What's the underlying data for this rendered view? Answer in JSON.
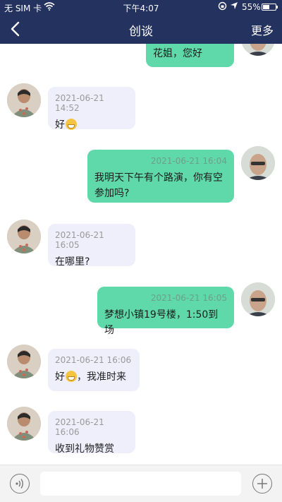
{
  "status_bar": {
    "carrier": "无 SIM 卡",
    "time": "下午4:07",
    "battery": "55%",
    "battery_level": 0.55
  },
  "nav": {
    "title": "创谈",
    "more": "更多"
  },
  "messages": [
    {
      "side": "out",
      "timestamp": "",
      "text": "花姐，您好"
    },
    {
      "side": "in",
      "timestamp": "2021-06-21 14:52",
      "text": "好"
    },
    {
      "side": "out",
      "timestamp": "2021-06-21 16:04",
      "text_line1": "我明天下午有个路演，你有空",
      "text_line2": "参加吗?"
    },
    {
      "side": "in",
      "timestamp": "2021-06-21 16:05",
      "text": "在哪里?"
    },
    {
      "side": "out",
      "timestamp": "2021-06-21 16:05",
      "text": "梦想小镇19号楼，1:50到场"
    },
    {
      "side": "in",
      "timestamp": "2021-06-21 16:06",
      "text_before": "好",
      "text_after": "，我准时来"
    },
    {
      "side": "in",
      "timestamp": "2021-06-21 16:06",
      "text": "收到礼物赞赏"
    }
  ],
  "input": {
    "value": "",
    "placeholder": ""
  },
  "colors": {
    "header": "#24325f",
    "outgoing_bubble": "#5fd8aa",
    "incoming_bubble": "#efeefb"
  }
}
